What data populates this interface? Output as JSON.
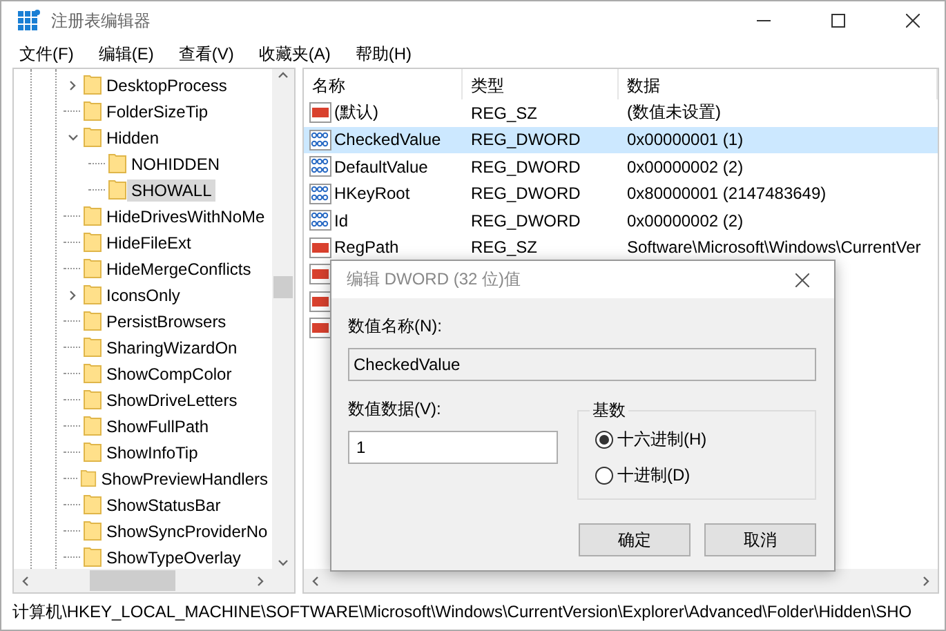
{
  "window": {
    "title": "注册表编辑器"
  },
  "menu": [
    "文件(F)",
    "编辑(E)",
    "查看(V)",
    "收藏夹(A)",
    "帮助(H)"
  ],
  "tree": [
    {
      "label": "DesktopProcess",
      "expanded": false,
      "selected": false
    },
    {
      "label": "FolderSizeTip",
      "selected": false
    },
    {
      "label": "Hidden",
      "expanded": true,
      "selected": false,
      "children": [
        {
          "label": "NOHIDDEN",
          "selected": false
        },
        {
          "label": "SHOWALL",
          "selected": true
        }
      ]
    },
    {
      "label": "HideDrivesWithNoMe",
      "selected": false
    },
    {
      "label": "HideFileExt",
      "selected": false
    },
    {
      "label": "HideMergeConflicts",
      "selected": false
    },
    {
      "label": "IconsOnly",
      "expanded": false,
      "selected": false
    },
    {
      "label": "PersistBrowsers",
      "selected": false
    },
    {
      "label": "SharingWizardOn",
      "selected": false
    },
    {
      "label": "ShowCompColor",
      "selected": false
    },
    {
      "label": "ShowDriveLetters",
      "selected": false
    },
    {
      "label": "ShowFullPath",
      "selected": false
    },
    {
      "label": "ShowInfoTip",
      "selected": false
    },
    {
      "label": "ShowPreviewHandlers",
      "selected": false
    },
    {
      "label": "ShowStatusBar",
      "selected": false
    },
    {
      "label": "ShowSyncProviderNo",
      "selected": false
    },
    {
      "label": "ShowTypeOverlay",
      "selected": false
    }
  ],
  "table": {
    "columns": [
      "名称",
      "类型",
      "数据"
    ],
    "rows": [
      {
        "kind": "string",
        "name": "(默认)",
        "type": "REG_SZ",
        "data": "(数值未设置)",
        "selected": false
      },
      {
        "kind": "binary",
        "name": "CheckedValue",
        "type": "REG_DWORD",
        "data": "0x00000001 (1)",
        "selected": true
      },
      {
        "kind": "binary",
        "name": "DefaultValue",
        "type": "REG_DWORD",
        "data": "0x00000002 (2)",
        "selected": false
      },
      {
        "kind": "binary",
        "name": "HKeyRoot",
        "type": "REG_DWORD",
        "data": "0x80000001 (2147483649)",
        "selected": false
      },
      {
        "kind": "binary",
        "name": "Id",
        "type": "REG_DWORD",
        "data": "0x00000002 (2)",
        "selected": false
      },
      {
        "kind": "string",
        "name": "RegPath",
        "type": "REG_SZ",
        "data": "Software\\Microsoft\\Windows\\CurrentVer",
        "selected": false
      },
      {
        "kind": "string",
        "selected": false
      },
      {
        "kind": "string",
        "selected": false
      },
      {
        "kind": "string",
        "selected": false
      }
    ]
  },
  "dialog": {
    "title": "编辑 DWORD (32 位)值",
    "name_label": "数值名称(N):",
    "name_value": "CheckedValue",
    "data_label": "数值数据(V):",
    "data_value": "1",
    "base_label": "基数",
    "bases": [
      {
        "label": "十六进制(H)",
        "selected": true
      },
      {
        "label": "十进制(D)",
        "selected": false
      }
    ],
    "buttons": [
      "确定",
      "取消"
    ]
  },
  "status_bar": "计算机\\HKEY_LOCAL_MACHINE\\SOFTWARE\\Microsoft\\Windows\\CurrentVersion\\Explorer\\Advanced\\Folder\\Hidden\\SHO"
}
